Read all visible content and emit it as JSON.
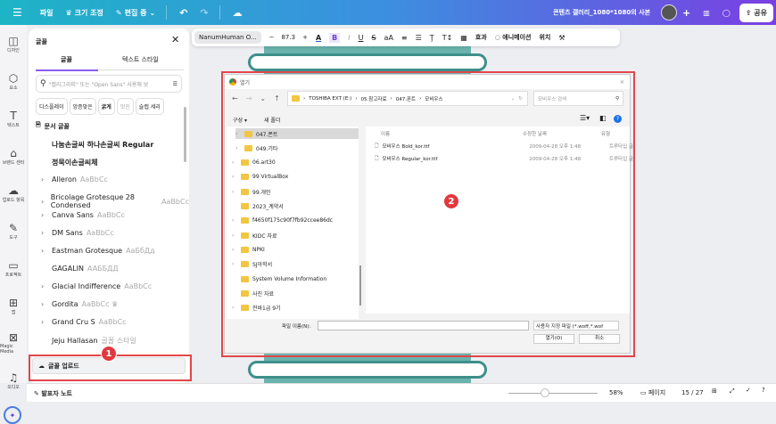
{
  "topbar": {
    "file": "파일",
    "resize": "크기 조정",
    "edit": "편집 중",
    "title": "콘텐츠 갤러리_1080*1080의 사본",
    "share": "공유"
  },
  "rail": [
    {
      "label": "디자인",
      "icon": "layout-icon"
    },
    {
      "label": "요소",
      "icon": "shapes-icon"
    },
    {
      "label": "텍스트",
      "icon": "text-icon"
    },
    {
      "label": "브랜드 센터",
      "icon": "brand-icon"
    },
    {
      "label": "업로드 항목",
      "icon": "upload-icon"
    },
    {
      "label": "도구",
      "icon": "pen-icon"
    },
    {
      "label": "프로젝트",
      "icon": "folder-icon"
    },
    {
      "label": "앱",
      "icon": "apps-icon"
    },
    {
      "label": "Magic Media",
      "icon": "magic-icon"
    },
    {
      "label": "오디오",
      "icon": "music-icon"
    }
  ],
  "panel": {
    "title": "글꼴",
    "tabs": [
      "글꼴",
      "텍스트 스타일"
    ],
    "search_placeholder": "\"캘리그라피\" 또는 \"Open Sans\" 사용해 보",
    "chips": [
      "디스플레이",
      "앙증맞은",
      "굵게",
      "멋진",
      "슬랩 세리"
    ],
    "doc_fonts_label": "문서 글꼴",
    "fonts": [
      {
        "name": "나눔손글씨 하나손글씨 Regular",
        "sample": "",
        "expand": false
      },
      {
        "name": "정묵이손글씨체",
        "sample": "",
        "expand": false
      },
      {
        "name": "Alleron",
        "sample": "AaBbCc",
        "expand": true
      },
      {
        "name": "Bricolage Grotesque 28 Condensed",
        "sample": "AaBbCc",
        "expand": true
      },
      {
        "name": "Canva Sans",
        "sample": "AaBbCc",
        "expand": true
      },
      {
        "name": "DM Sans",
        "sample": "AaBbCc",
        "expand": true
      },
      {
        "name": "Eastman Grotesque",
        "sample": "AaБбДд",
        "expand": true
      },
      {
        "name": "GAGALIN",
        "sample": "AAББДД",
        "expand": false
      },
      {
        "name": "Glacial Indifference",
        "sample": "AaBbCc",
        "expand": true
      },
      {
        "name": "Gordita",
        "sample": "AaBbCc ♛",
        "expand": true
      },
      {
        "name": "Grand Cru S",
        "sample": "AaBbCc",
        "expand": true
      },
      {
        "name": "Jeju Hallasan",
        "sample": "글꼴 스타일",
        "expand": false
      }
    ],
    "upload": "글꼴 업로드"
  },
  "toolbar": {
    "font": "NanumHuman O...",
    "size": "87.3",
    "effects": "효과",
    "animate": "애니메이션",
    "position": "위치"
  },
  "dialog": {
    "title": "열기",
    "path": [
      "TOSHIBA EXT (E:)",
      "05.참고자료",
      "047.폰트",
      "모비우스"
    ],
    "search": "모비우스 검색",
    "organize": "구성 ▾",
    "new_folder": "새 폴더",
    "tree": [
      {
        "name": "047.폰트",
        "sel": true,
        "sub": true
      },
      {
        "name": "049.기타",
        "sub": true
      },
      {
        "name": "06.art30"
      },
      {
        "name": "99 VirtualBox"
      },
      {
        "name": "99.개인"
      },
      {
        "name": "2023_계약서",
        "noexp": true
      },
      {
        "name": "f4650f175c90f7fb92ccee86dc"
      },
      {
        "name": "KIDC 자료"
      },
      {
        "name": "NPKI"
      },
      {
        "name": "SJ아학서"
      },
      {
        "name": "System Volume Information",
        "noexp": true
      },
      {
        "name": "사진 자료",
        "noexp": true
      },
      {
        "name": "전바1급 9기"
      }
    ],
    "columns": [
      "이름",
      "수정한 날짜",
      "유형"
    ],
    "files": [
      {
        "name": "모비우스 Bold_kor.ttf",
        "date": "2009-04-28 오후 1:48",
        "type": "트루타입 글"
      },
      {
        "name": "모비우스 Regular_kor.ttf",
        "date": "2009-04-28 오후 1:48",
        "type": "트루타입 글"
      }
    ],
    "filename_label": "파일 이름(N):",
    "filter": "사용자 지정 파일 (*.woff,*.wof",
    "open": "열기(O)",
    "cancel": "취소"
  },
  "badges": [
    "1",
    "2"
  ],
  "bottom": {
    "notes": "발표자 노트",
    "zoom": "58%",
    "pages_label": "페이지",
    "page": "15 / 27"
  }
}
